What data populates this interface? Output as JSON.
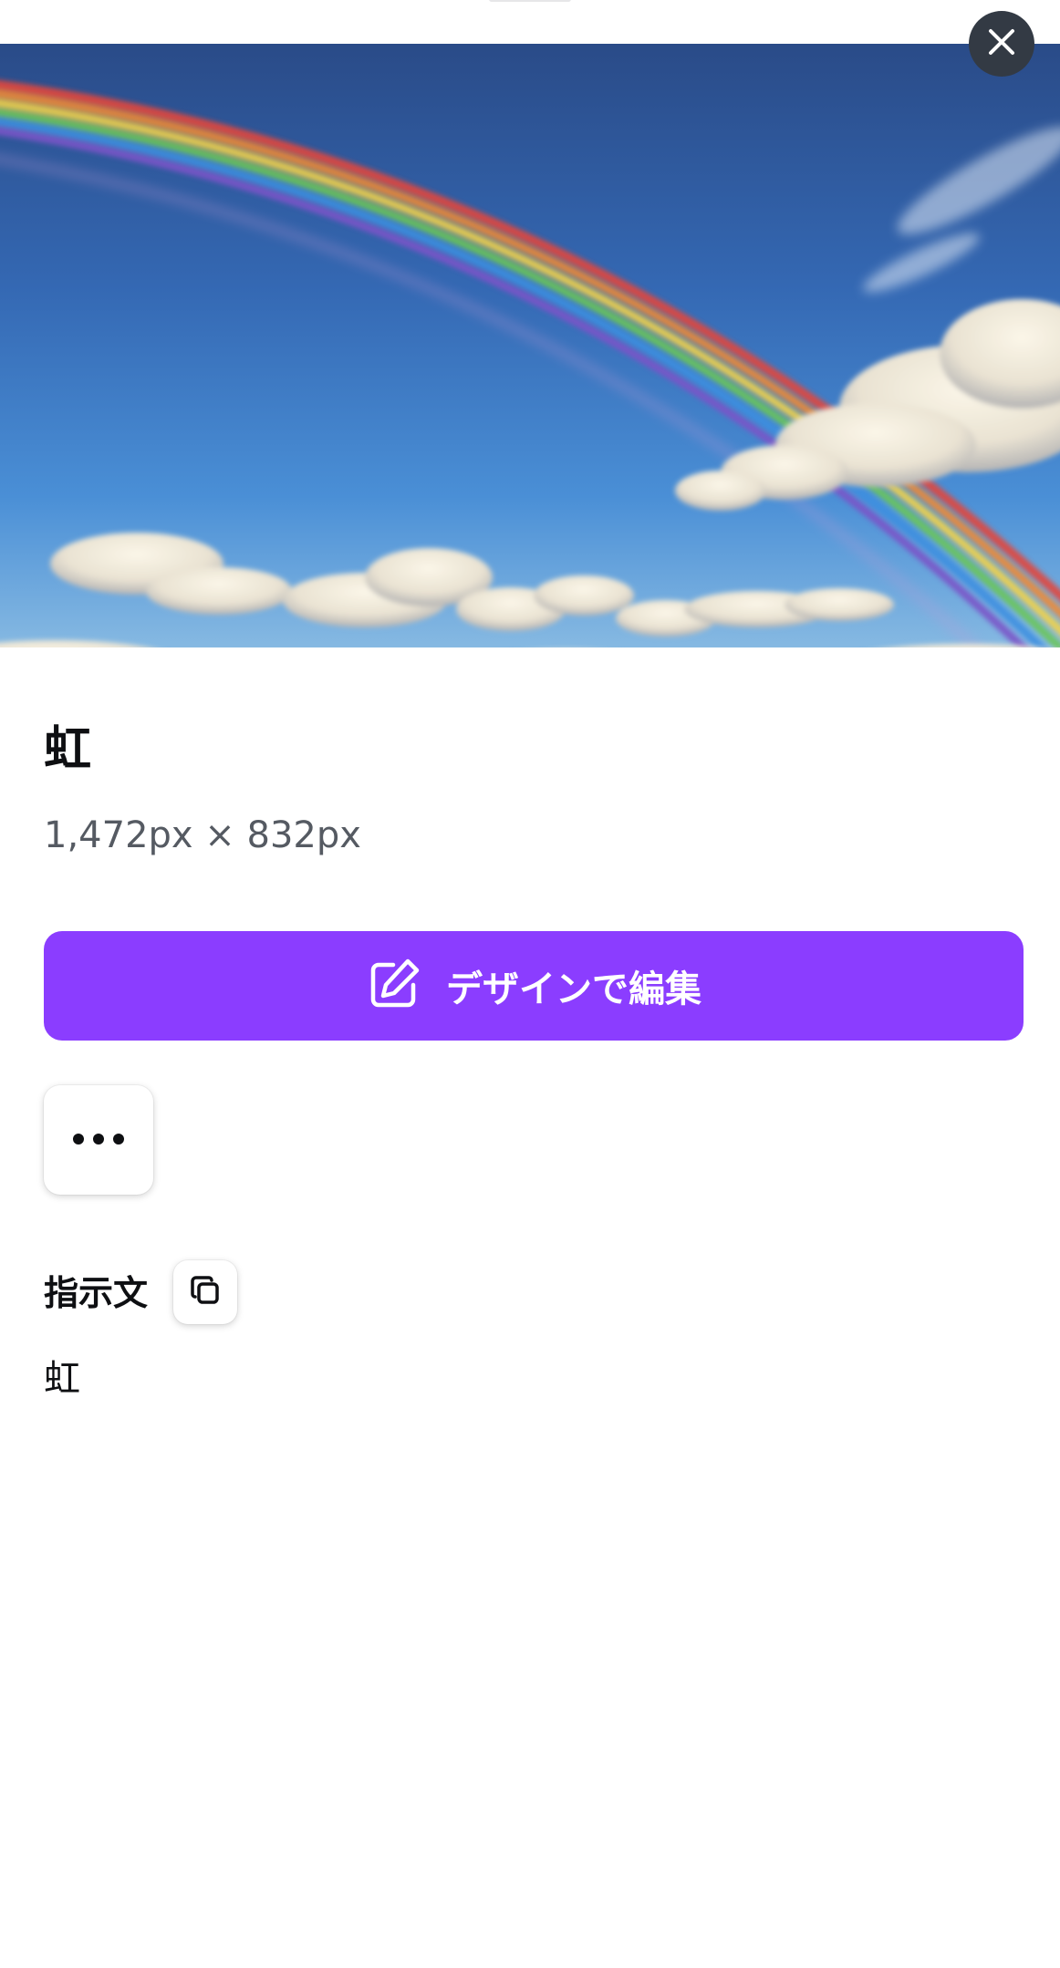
{
  "dialog": {
    "close_icon": "close-icon"
  },
  "preview": {
    "alt": "虹"
  },
  "asset": {
    "title": "虹",
    "dimensions": "1,472px × 832px"
  },
  "actions": {
    "edit_label": "デザインで編集",
    "edit_icon": "pencil-edit-icon",
    "more_icon": "more-horizontal-icon",
    "accent_color": "#8b3dff"
  },
  "prompt": {
    "label": "指示文",
    "copy_icon": "copy-icon",
    "text": "虹"
  }
}
